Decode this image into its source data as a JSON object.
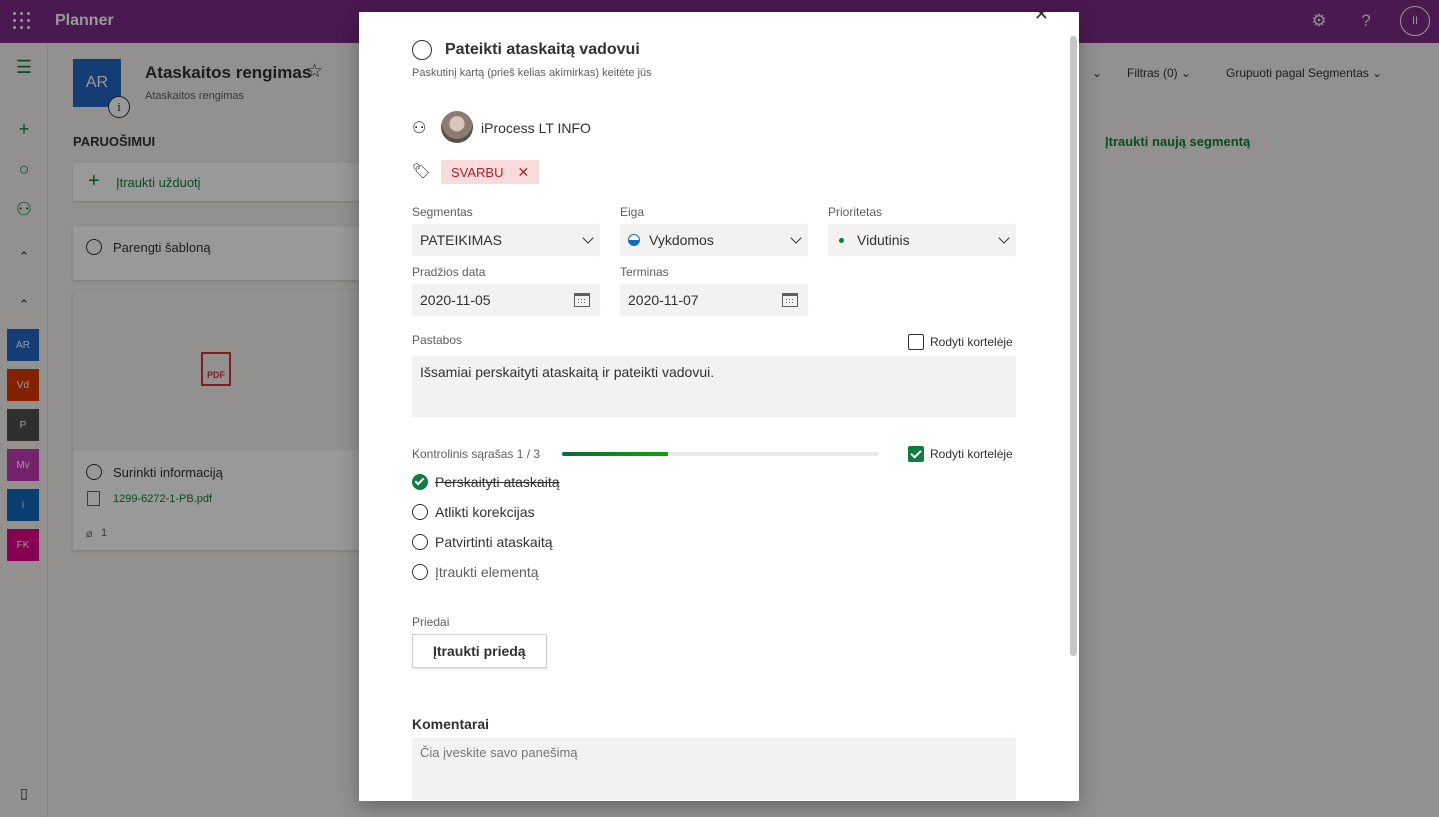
{
  "app": {
    "title": "Planner",
    "user_initials": "II"
  },
  "plan": {
    "logo": "AR",
    "title": "Ataskaitos rengimas",
    "subtitle": "Ataskaitos rengimas",
    "bucket": "PARUOŠIMUI",
    "add_task": "Įtraukti užduotį",
    "tasks": [
      {
        "title": "Parengti šabloną"
      },
      {
        "title": "Surinkti informaciją",
        "attachment": "1299-6272-1-PB.pdf",
        "attachment_count": "1",
        "preview_label": "PDF"
      }
    ],
    "add_bucket": "Įtraukti naują segmentą"
  },
  "rail": {
    "plans": [
      "AR",
      "Vd",
      "P",
      "Mv",
      "i",
      "FK"
    ]
  },
  "filters": {
    "filter_label": "Filtras (0)",
    "group_label": "Grupuoti pagal Segmentas"
  },
  "task": {
    "title": "Pateikti ataskaitą vadovui",
    "modified": "Paskutinį kartą (prieš kelias akimirkas) keitėte jūs",
    "assignee": "iProcess LT INFO",
    "label": "SVARBU",
    "bucket_label": "Segmentas",
    "bucket_value": "PATEIKIMAS",
    "progress_label": "Eiga",
    "progress_value": "Vykdomos",
    "priority_label": "Prioritetas",
    "priority_value": "Vidutinis",
    "start_label": "Pradžios data",
    "start_value": "2020-11-05",
    "due_label": "Terminas",
    "due_value": "2020-11-07",
    "notes_label": "Pastabos",
    "notes_show": "Rodyti kortelėje",
    "notes_value": "Išsamiai perskaityti ataskaitą ir pateikti vadovui.",
    "checklist_label": "Kontrolinis sąrašas 1 / 3",
    "checklist_fraction": 0.333,
    "checklist_show": "Rodyti kortelėje",
    "checklist": [
      {
        "text": "Perskaityti ataskaitą",
        "done": true
      },
      {
        "text": "Atlikti korekcijas",
        "done": false
      },
      {
        "text": "Patvirtinti ataskaitą",
        "done": false
      }
    ],
    "checklist_add": "Įtraukti elementą",
    "attachments_label": "Priedai",
    "attachments_button": "Įtraukti priedą",
    "comments_label": "Komentarai",
    "comments_placeholder": "Čia įveskite savo panešimą"
  },
  "colors": {
    "brand": "#7b2a86",
    "accent": "#107c41",
    "label": "#fadbdc"
  }
}
